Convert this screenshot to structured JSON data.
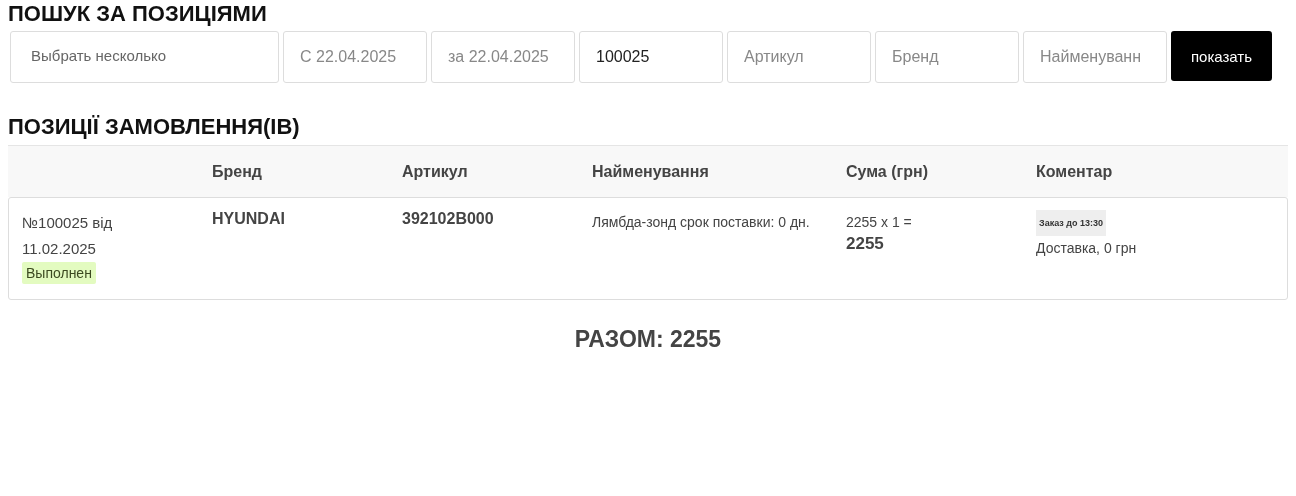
{
  "search_title": "ПОШУК ЗА ПОЗИЦІЯМИ",
  "filters": [
    {
      "kind": "select",
      "placeholder": "Выбрать несколько"
    },
    {
      "kind": "input",
      "placeholder": "С 22.04.2025"
    },
    {
      "kind": "input",
      "placeholder": "за 22.04.2025"
    },
    {
      "kind": "input",
      "value": "100025"
    },
    {
      "kind": "input",
      "placeholder": "Артикул"
    },
    {
      "kind": "input",
      "placeholder": "Бренд"
    },
    {
      "kind": "input",
      "placeholder": "Найменуванн"
    }
  ],
  "show_button": "показать",
  "items_title": "ПОЗИЦІЇ ЗАМОВЛЕННЯ(ІВ)",
  "table": {
    "columns": [
      "",
      "Бренд",
      "Артикул",
      "Найменування",
      "Сума (грн)",
      "Коментар"
    ],
    "rows": [
      {
        "order": "№100025 від",
        "date": "11.02.2025",
        "status": "Выполнен",
        "brand": "HYUNDAI",
        "article": "392102B000",
        "name": "Лямбда-зонд срок поставки: 0 дн.",
        "calc": "2255 x 1 =",
        "sum": "2255",
        "tag": "Заказ до 13:30",
        "comment": "Доставка, 0 грн"
      }
    ]
  },
  "total": "РАЗОМ: 2255"
}
